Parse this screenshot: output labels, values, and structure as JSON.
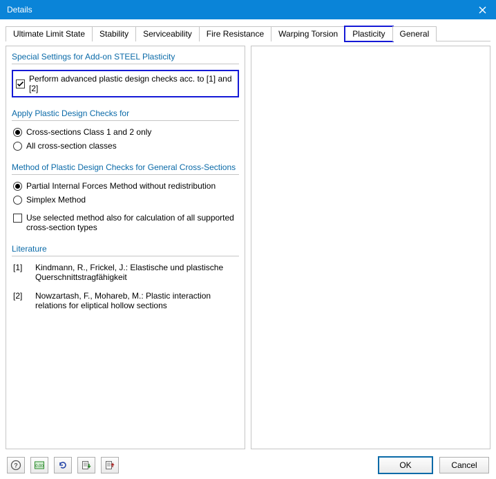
{
  "window": {
    "title": "Details"
  },
  "tabs": {
    "t0": "Ultimate Limit State",
    "t1": "Stability",
    "t2": "Serviceability",
    "t3": "Fire Resistance",
    "t4": "Warping Torsion",
    "t5": "Plasticity",
    "t6": "General",
    "active": "t5",
    "highlighted": "t5"
  },
  "groups": {
    "special": {
      "title": "Special Settings for Add-on STEEL Plasticity",
      "perform_advanced": {
        "label": "Perform advanced plastic design checks acc. to [1] and [2]",
        "checked": true,
        "highlighted": true
      }
    },
    "apply": {
      "title": "Apply Plastic Design Checks for",
      "opt1": {
        "label": "Cross-sections Class 1 and 2 only",
        "selected": true
      },
      "opt2": {
        "label": "All cross-section classes",
        "selected": false
      }
    },
    "method": {
      "title": "Method of Plastic Design Checks for General Cross-Sections",
      "opt1": {
        "label": "Partial Internal Forces Method without redistribution",
        "selected": true
      },
      "opt2": {
        "label": "Simplex Method",
        "selected": false
      },
      "use_also": {
        "label": "Use selected method also for calculation of all supported",
        "label_line2": "cross-section types",
        "checked": false
      }
    },
    "literature": {
      "title": "Literature",
      "items": [
        {
          "num": "[1]",
          "text": "Kindmann, R., Frickel, J.: Elastische und plastische Querschnittstragfähigkeit"
        },
        {
          "num": "[2]",
          "text": "Nowzartash, F., Mohareb, M.: Plastic interaction relations for eliptical hollow sections"
        }
      ]
    }
  },
  "footer": {
    "ok": "OK",
    "cancel": "Cancel"
  }
}
